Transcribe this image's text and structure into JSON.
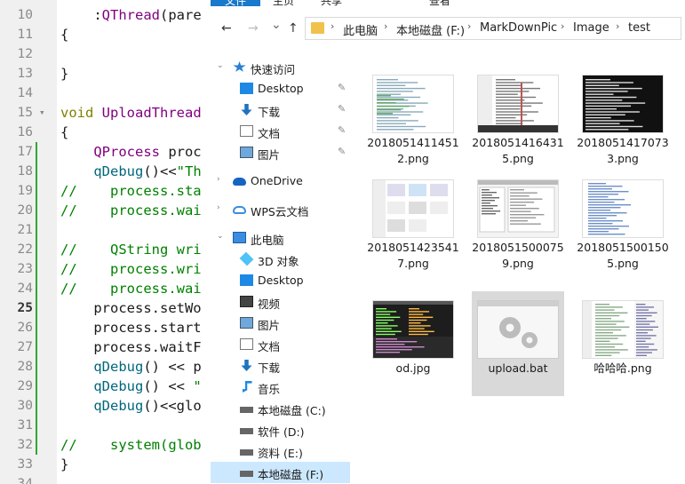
{
  "editor": {
    "lines": [
      {
        "num": "10",
        "parts": [
          {
            "t": "    :",
            "c": ""
          },
          {
            "t": "QThread",
            "c": "c-type"
          },
          {
            "t": "(pare",
            "c": ""
          }
        ],
        "fold": false
      },
      {
        "num": "11",
        "parts": [
          {
            "t": "{",
            "c": ""
          }
        ],
        "fold": false
      },
      {
        "num": "12",
        "parts": [],
        "fold": false
      },
      {
        "num": "13",
        "parts": [
          {
            "t": "}",
            "c": ""
          }
        ],
        "fold": false
      },
      {
        "num": "14",
        "parts": [],
        "fold": false
      },
      {
        "num": "15",
        "parts": [
          {
            "t": "void",
            "c": "c-kw"
          },
          {
            "t": " ",
            "c": ""
          },
          {
            "t": "UploadThread",
            "c": "c-type"
          }
        ],
        "fold": true
      },
      {
        "num": "16",
        "parts": [
          {
            "t": "{",
            "c": ""
          }
        ],
        "fold": false
      },
      {
        "num": "17",
        "parts": [
          {
            "t": "    ",
            "c": ""
          },
          {
            "t": "QProcess",
            "c": "c-type"
          },
          {
            "t": " proc",
            "c": ""
          }
        ],
        "fold": false
      },
      {
        "num": "18",
        "parts": [
          {
            "t": "    ",
            "c": ""
          },
          {
            "t": "qDebug",
            "c": "c-fn"
          },
          {
            "t": "()<<",
            "c": ""
          },
          {
            "t": "\"Th",
            "c": "c-str"
          }
        ],
        "fold": false
      },
      {
        "num": "19",
        "parts": [
          {
            "t": "//    process.sta",
            "c": "c-cmt"
          }
        ],
        "fold": false
      },
      {
        "num": "20",
        "parts": [
          {
            "t": "//    process.wai",
            "c": "c-cmt"
          }
        ],
        "fold": false
      },
      {
        "num": "21",
        "parts": [],
        "fold": false
      },
      {
        "num": "22",
        "parts": [
          {
            "t": "//    QString wri",
            "c": "c-cmt"
          }
        ],
        "fold": false
      },
      {
        "num": "23",
        "parts": [
          {
            "t": "//    process.wri",
            "c": "c-cmt"
          }
        ],
        "fold": false
      },
      {
        "num": "24",
        "parts": [
          {
            "t": "//    process.wai",
            "c": "c-cmt"
          }
        ],
        "fold": false
      },
      {
        "num": "25",
        "parts": [
          {
            "t": "    process.setWo",
            "c": ""
          }
        ],
        "fold": false,
        "current": true
      },
      {
        "num": "26",
        "parts": [
          {
            "t": "    process.start",
            "c": ""
          }
        ],
        "fold": false
      },
      {
        "num": "27",
        "parts": [
          {
            "t": "    process.waitF",
            "c": ""
          }
        ],
        "fold": false
      },
      {
        "num": "28",
        "parts": [
          {
            "t": "    ",
            "c": ""
          },
          {
            "t": "qDebug",
            "c": "c-fn"
          },
          {
            "t": "() << p",
            "c": ""
          }
        ],
        "fold": false
      },
      {
        "num": "29",
        "parts": [
          {
            "t": "    ",
            "c": ""
          },
          {
            "t": "qDebug",
            "c": "c-fn"
          },
          {
            "t": "() << ",
            "c": ""
          },
          {
            "t": "\"",
            "c": "c-str"
          }
        ],
        "fold": false
      },
      {
        "num": "30",
        "parts": [
          {
            "t": "    ",
            "c": ""
          },
          {
            "t": "qDebug",
            "c": "c-fn"
          },
          {
            "t": "()<<glo",
            "c": ""
          }
        ],
        "fold": false
      },
      {
        "num": "31",
        "parts": [],
        "fold": false
      },
      {
        "num": "32",
        "parts": [
          {
            "t": "//    system(glob",
            "c": "c-cmt"
          }
        ],
        "fold": false
      },
      {
        "num": "33",
        "parts": [
          {
            "t": "}",
            "c": ""
          }
        ],
        "fold": false
      },
      {
        "num": "34",
        "parts": [],
        "fold": false
      }
    ]
  },
  "explorer": {
    "ribbon_tabs": [
      "文件",
      "主页",
      "共享",
      "查看"
    ],
    "back_icon": "←",
    "forward_icon": "→",
    "recent_icon": "⌄",
    "up_icon": "↑",
    "breadcrumb": [
      "此电脑",
      "本地磁盘 (F:)",
      "MarkDownPic",
      "Image",
      "test"
    ],
    "nav": [
      {
        "label": "快速访问",
        "icon": "star-icon",
        "level": 0,
        "pin": false
      },
      {
        "label": "Desktop",
        "icon": "desktop-icon",
        "level": 1,
        "pin": true
      },
      {
        "label": "下载",
        "icon": "download-icon",
        "level": 1,
        "pin": true
      },
      {
        "label": "文档",
        "icon": "document-icon",
        "level": 1,
        "pin": true
      },
      {
        "label": "图片",
        "icon": "picture-icon",
        "level": 1,
        "pin": true
      },
      {
        "label": "",
        "icon": "",
        "level": -1,
        "pin": false
      },
      {
        "label": "OneDrive",
        "icon": "cloud-icon",
        "level": 0,
        "pin": false
      },
      {
        "label": "",
        "icon": "",
        "level": -1,
        "pin": false
      },
      {
        "label": "WPS云文档",
        "icon": "wps-cloud-icon",
        "level": 0,
        "pin": false
      },
      {
        "label": "",
        "icon": "",
        "level": -1,
        "pin": false
      },
      {
        "label": "此电脑",
        "icon": "computer-icon",
        "level": 0,
        "pin": false
      },
      {
        "label": "3D 对象",
        "icon": "3d-objects-icon",
        "level": 1,
        "pin": false
      },
      {
        "label": "Desktop",
        "icon": "desktop-icon",
        "level": 1,
        "pin": false
      },
      {
        "label": "视频",
        "icon": "video-icon",
        "level": 1,
        "pin": false
      },
      {
        "label": "图片",
        "icon": "picture-icon",
        "level": 1,
        "pin": false
      },
      {
        "label": "文档",
        "icon": "document-icon",
        "level": 1,
        "pin": false
      },
      {
        "label": "下载",
        "icon": "download-icon",
        "level": 1,
        "pin": false
      },
      {
        "label": "音乐",
        "icon": "music-icon",
        "level": 1,
        "pin": false
      },
      {
        "label": "本地磁盘 (C:)",
        "icon": "drive-icon",
        "level": 1,
        "pin": false
      },
      {
        "label": "软件 (D:)",
        "icon": "drive-icon",
        "level": 1,
        "pin": false
      },
      {
        "label": "资料 (E:)",
        "icon": "drive-icon",
        "level": 1,
        "pin": false
      },
      {
        "label": "本地磁盘 (F:)",
        "icon": "drive-icon",
        "level": 1,
        "pin": false,
        "selected": true
      }
    ],
    "files": [
      {
        "name": "20180514114512.png",
        "thumb": "light-doc"
      },
      {
        "name": "20180514164315.png",
        "thumb": "editor"
      },
      {
        "name": "20180514170733.png",
        "thumb": "terminal"
      },
      {
        "name": "20180514235417.png",
        "thumb": "gallery"
      },
      {
        "name": "20180515000759.png",
        "thumb": "ide"
      },
      {
        "name": "20180515001505.png",
        "thumb": "list"
      },
      {
        "name": "od.jpg",
        "thumb": "dark"
      },
      {
        "name": "upload.bat",
        "thumb": "bat",
        "selected": true
      },
      {
        "name": "哈哈哈.png",
        "thumb": "editor2"
      }
    ]
  }
}
